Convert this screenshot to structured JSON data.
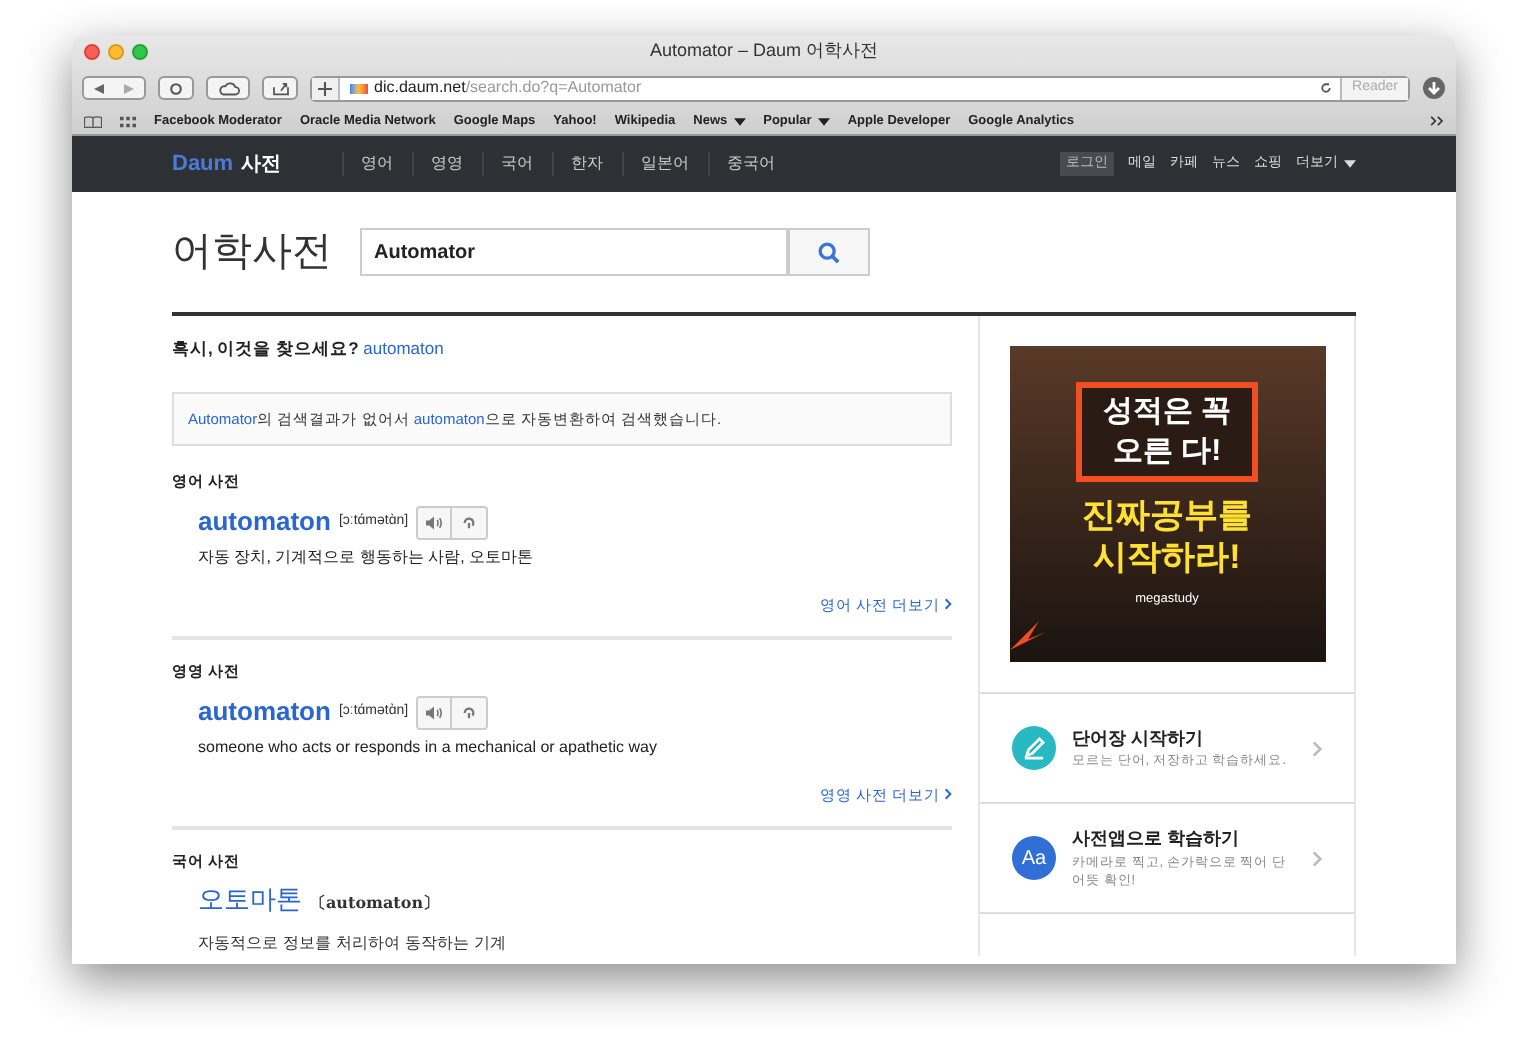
{
  "window": {
    "title": "Automator – Daum 어학사전"
  },
  "toolbar": {
    "url_host": "dic.daum.net",
    "url_path": "/search.do?q=Automator",
    "reader": "Reader"
  },
  "bookmarks": [
    {
      "label": "Facebook Moderator",
      "menu": false
    },
    {
      "label": "Oracle Media Network",
      "menu": false
    },
    {
      "label": "Google Maps",
      "menu": false
    },
    {
      "label": "Yahoo!",
      "menu": false
    },
    {
      "label": "Wikipedia",
      "menu": false
    },
    {
      "label": "News",
      "menu": true
    },
    {
      "label": "Popular",
      "menu": true
    },
    {
      "label": "Apple Developer",
      "menu": false
    },
    {
      "label": "Google Analytics",
      "menu": false
    }
  ],
  "site_nav": {
    "logo": "Daum",
    "section": "사전",
    "tabs": [
      {
        "label": "영어"
      },
      {
        "label": "영영"
      },
      {
        "label": "국어"
      },
      {
        "label": "한자"
      },
      {
        "label": "일본어"
      },
      {
        "label": "중국어"
      }
    ],
    "links": [
      {
        "label": "로그인",
        "kind": "button"
      },
      {
        "label": "메일",
        "kind": "link"
      },
      {
        "label": "카페",
        "kind": "link"
      },
      {
        "label": "뉴스",
        "kind": "link"
      },
      {
        "label": "쇼핑",
        "kind": "link"
      },
      {
        "label": "더보기",
        "kind": "menu"
      }
    ]
  },
  "search": {
    "title": "어학사전",
    "value": "Automator"
  },
  "suggestion": {
    "prompt": "혹시, 이것을 찾으세요?",
    "link": "automaton"
  },
  "notice": [
    {
      "kind": "link",
      "text": "Automator"
    },
    {
      "kind": "text",
      "text": "의 검색결과가 없어서 "
    },
    {
      "kind": "link",
      "text": "automaton"
    },
    {
      "kind": "text",
      "text": "으로 자동변환하여 검색했습니다."
    }
  ],
  "sections": [
    {
      "title": "영어 사전",
      "kind": "foreign",
      "word": "automaton",
      "note": "[ɔːtɑ́mətɑ̀n]",
      "meaning": "자동 장치, 기계적으로 행동하는 사람, 오토마톤",
      "more": "영어 사전 더보기"
    },
    {
      "title": "영영 사전",
      "kind": "foreign",
      "word": "automaton",
      "note": "[ɔːtɑ́mətɑ̀n]",
      "meaning": "someone who acts or responds in a mechanical or apathetic way",
      "more": "영영 사전 더보기"
    },
    {
      "title": "국어 사전",
      "kind": "native",
      "word": "오토마톤",
      "note": "〔automaton〕",
      "meaning": "자동적으로 정보를 처리하여 동작하는 기계"
    }
  ],
  "ad": {
    "headline": [
      "성적은 꼭",
      "오른 다!"
    ],
    "slogan": [
      "진짜공부를",
      "시작하라!"
    ],
    "brand": "megastudy"
  },
  "promos": [
    {
      "kind": "pencil",
      "title": "단어장 시작하기",
      "desc": "모르는 단어, 저장하고 학습하세요."
    },
    {
      "kind": "letters",
      "icon_text": "Aa",
      "title": "사전앱으로 학습하기",
      "desc": "카메라로 찍고, 손가락으로 찍어 단어뜻 확인!"
    }
  ]
}
